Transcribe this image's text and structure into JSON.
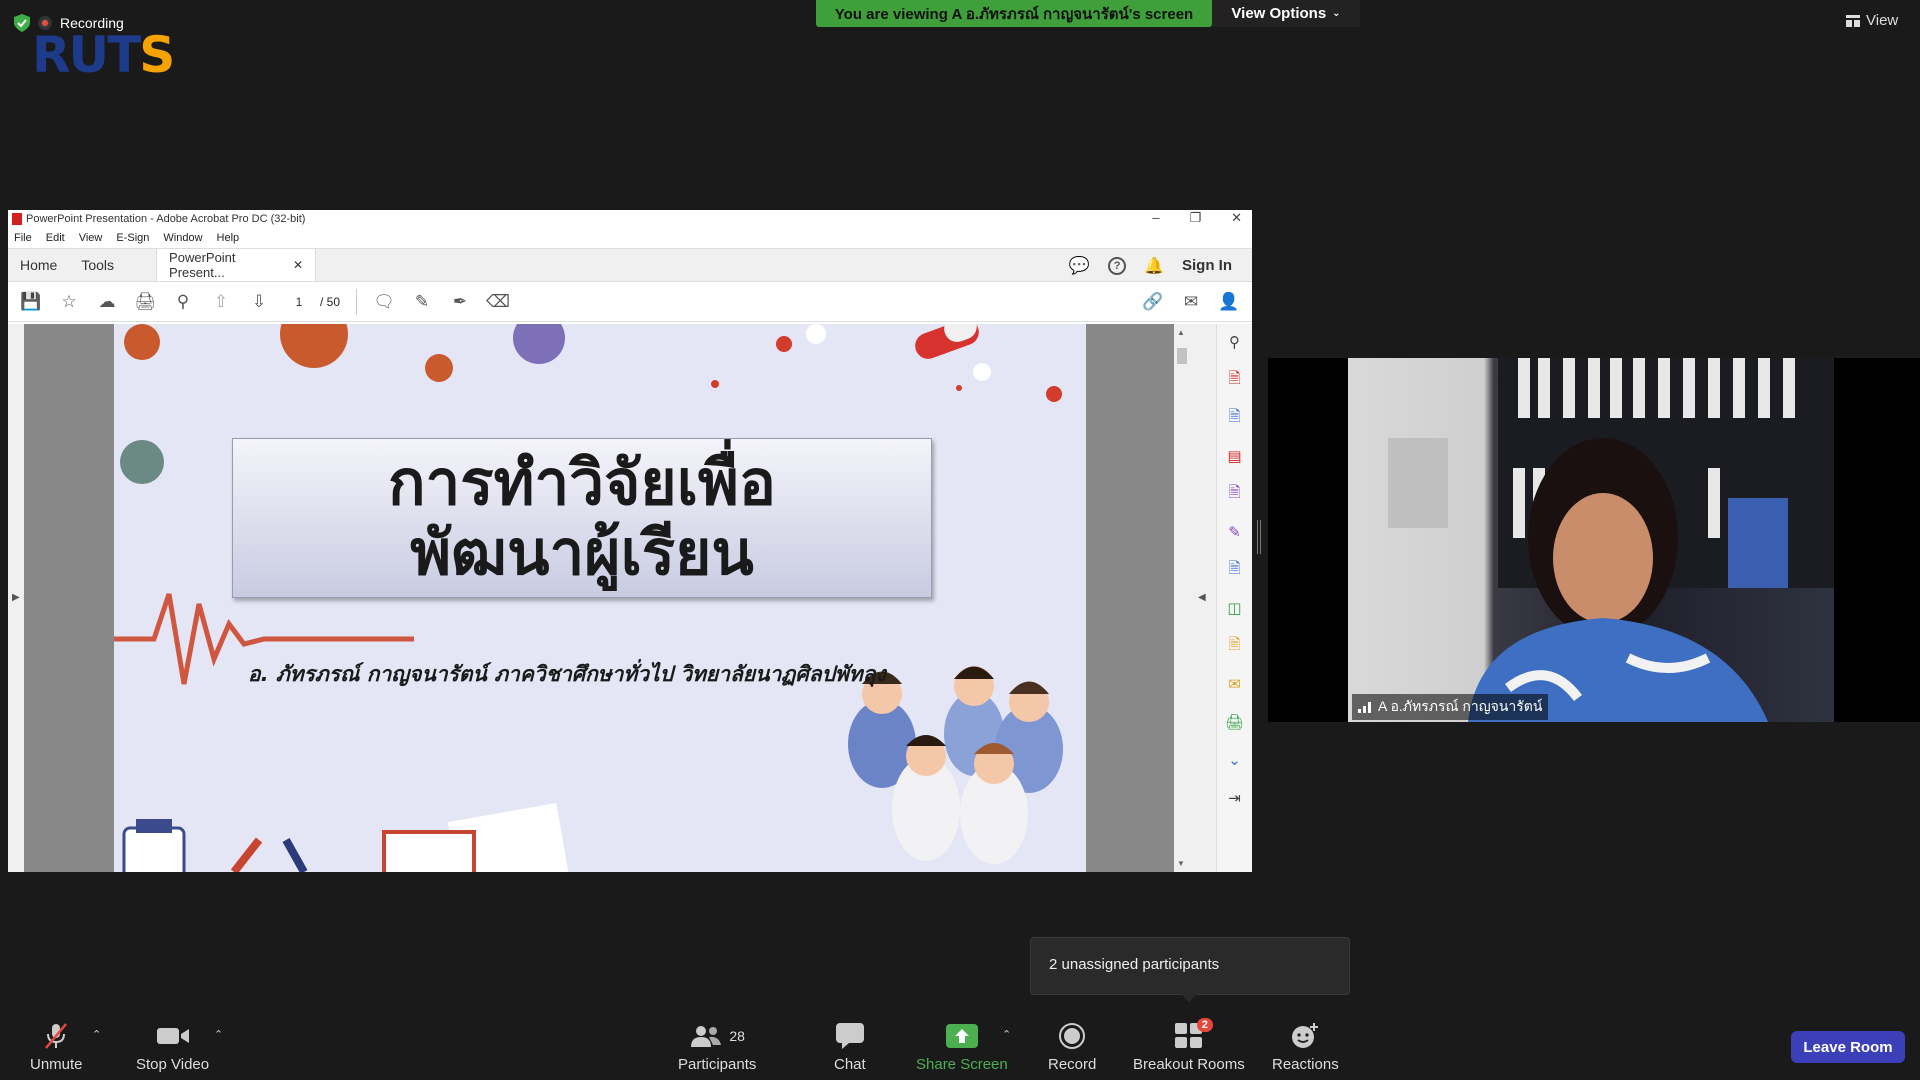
{
  "top": {
    "recording_label": "Recording",
    "logo_text_a": "RUT",
    "logo_text_b": "S",
    "view_banner": "You are viewing A อ.ภัทรภรณ์  กาญจนารัตน์'s screen",
    "view_options": "View Options",
    "view_button": "View"
  },
  "acrobat": {
    "window_title": "PowerPoint Presentation - Adobe Acrobat Pro DC (32-bit)",
    "menu": [
      "File",
      "Edit",
      "View",
      "E-Sign",
      "Window",
      "Help"
    ],
    "tabs": {
      "home": "Home",
      "tools": "Tools",
      "document": "PowerPoint Present..."
    },
    "sign_in": "Sign In",
    "page_current": "1",
    "page_total": "/ 50"
  },
  "slide": {
    "title_line1": "การทำวิจัยเพื่อ",
    "title_line2": "พัฒนาผู้เรียน",
    "subtitle": "อ. ภัทรภรณ์  กาญจนารัตน์  ภาควิชาศึกษาทั่วไป  วิทยาลัยนาฏศิลปพัทลุง"
  },
  "video": {
    "participant_name": "A อ.ภัทรภรณ์  กาญจนารัตน์"
  },
  "popup": {
    "text": "2 unassigned participants"
  },
  "bottom": {
    "unmute": "Unmute",
    "stop_video": "Stop Video",
    "participants": "Participants",
    "participants_count": "28",
    "chat": "Chat",
    "share_screen": "Share Screen",
    "record": "Record",
    "breakout_rooms": "Breakout Rooms",
    "breakout_badge": "2",
    "reactions": "Reactions",
    "leave_room": "Leave Room"
  },
  "colors": {
    "banner_green": "#3f9f3b",
    "share_green": "#4caf50",
    "leave_blue": "#3b3fb8",
    "badge_red": "#e5483b"
  }
}
